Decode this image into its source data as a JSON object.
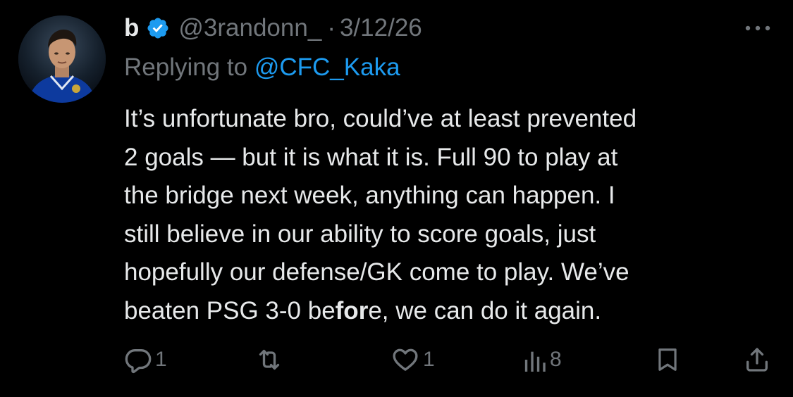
{
  "author": {
    "display_name": "b",
    "handle": "@3randonn_",
    "separator": "·",
    "date": "3/12/26"
  },
  "reply": {
    "prefix": "Replying to ",
    "mention": "@CFC_Kaka"
  },
  "body": {
    "lines": [
      "It’s unfortunate bro, could’ve at least prevented",
      "2 goals — but it is what it is. Full 90 to play at",
      "the bridge next week, anything can happen. I",
      "still believe in our ability to score goals, just",
      "hopefully our defense/GK come to play. We’ve"
    ],
    "last_line_before": "beaten PSG 3-0 be",
    "last_line_bold": "for",
    "last_line_after": "e, we can do it again."
  },
  "actions": {
    "reply_count": "1",
    "like_count": "1",
    "views_count": "8"
  },
  "icons": {
    "verified": "verified-badge-icon",
    "more": "more-dots-icon",
    "reply": "reply-icon",
    "repost": "repost-icon",
    "like": "heart-icon",
    "views": "views-icon",
    "bookmark": "bookmark-icon",
    "share": "share-icon"
  },
  "colors": {
    "background": "#000000",
    "text": "#e7e9ea",
    "muted": "#71767b",
    "accent": "#1d9bf0"
  }
}
